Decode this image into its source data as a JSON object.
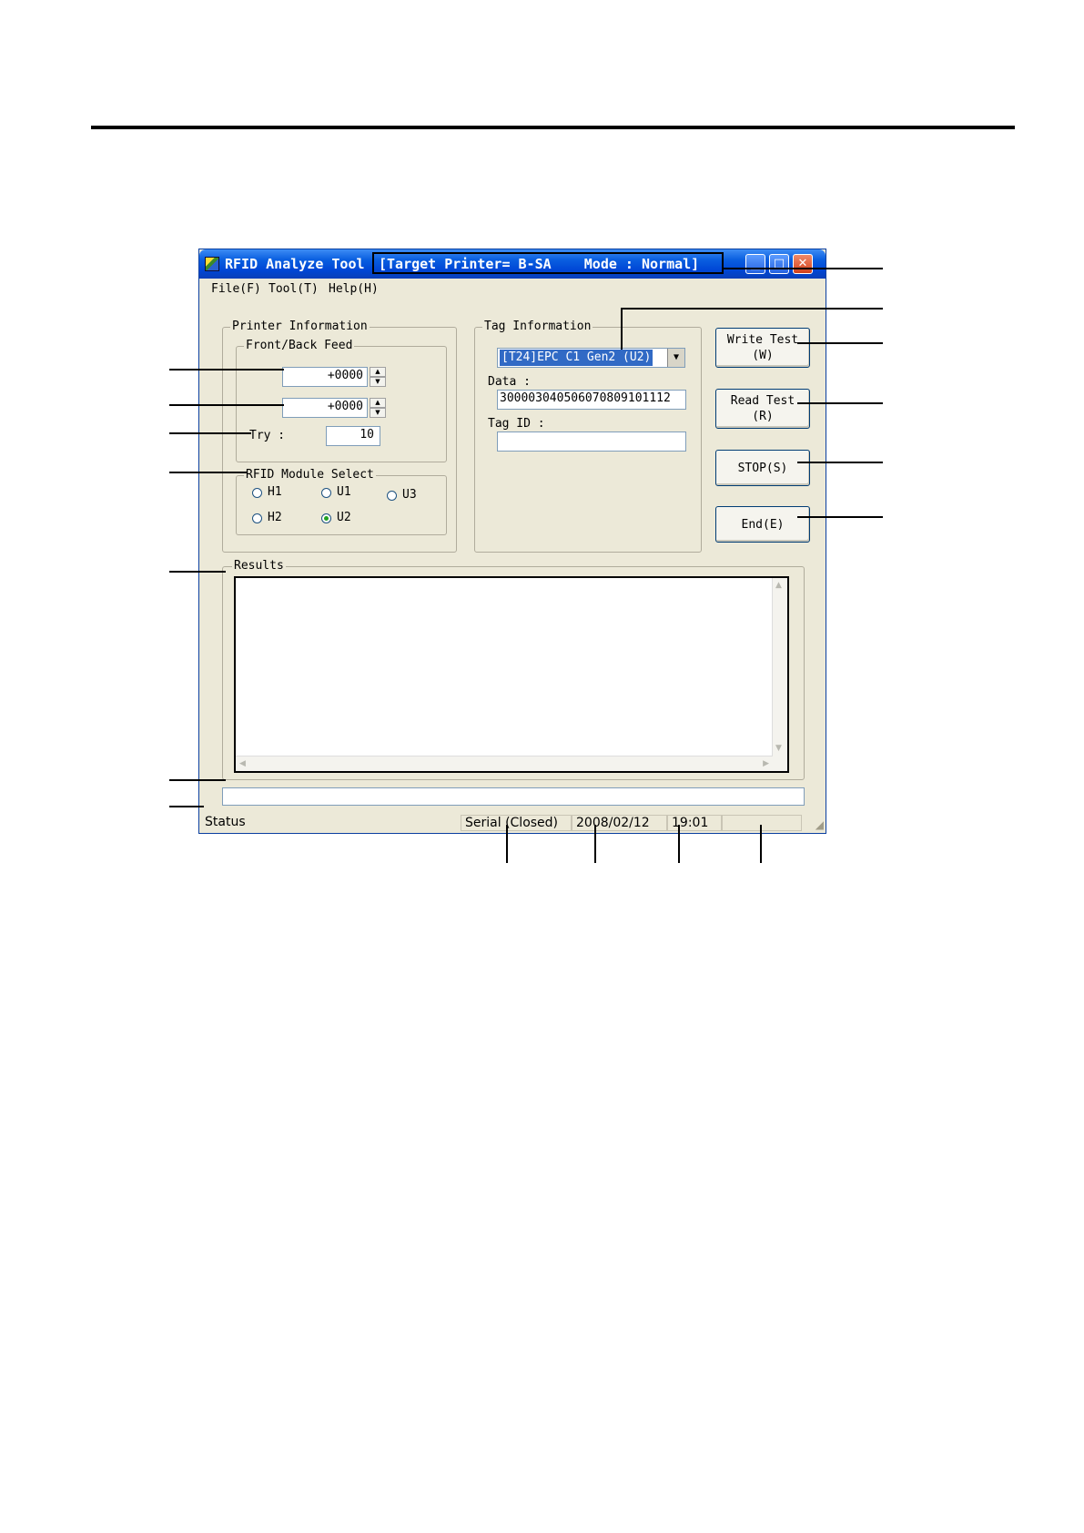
{
  "window": {
    "title": "RFID Analyze Tool",
    "title_target": "[Target Printer= B-SA    Mode : Normal]"
  },
  "menu": [
    "File(F)",
    "Tool(T)",
    "Help(H)"
  ],
  "printer_info": {
    "group_label": "Printer Information",
    "feed_group_label": "Front/Back Feed",
    "feed_front_value": "+0000",
    "feed_back_value": "+0000",
    "try_label": "Try :",
    "try_value": "10",
    "module_group_label": "RFID Module Select",
    "modules": [
      "H1",
      "U1",
      "U3",
      "H2",
      "U2"
    ],
    "selected_module": "U2"
  },
  "tag_info": {
    "group_label": "Tag Information",
    "tag_type": "[T24]EPC C1 Gen2 (U2)",
    "data_label": "Data :",
    "data_value": "300003040506070809101112",
    "tag_id_label": "Tag ID :",
    "tag_id_value": ""
  },
  "buttons": {
    "write_test": "Write Test\n(W)",
    "read_test": "Read Test\n(R)",
    "stop": "STOP(S)",
    "end": "End(E)"
  },
  "results": {
    "group_label": "Results"
  },
  "message_field": "",
  "status_bar": {
    "status": "Status",
    "port": "Serial (Closed)",
    "date": "2008/02/12",
    "time": "19:01",
    "extra": ""
  }
}
